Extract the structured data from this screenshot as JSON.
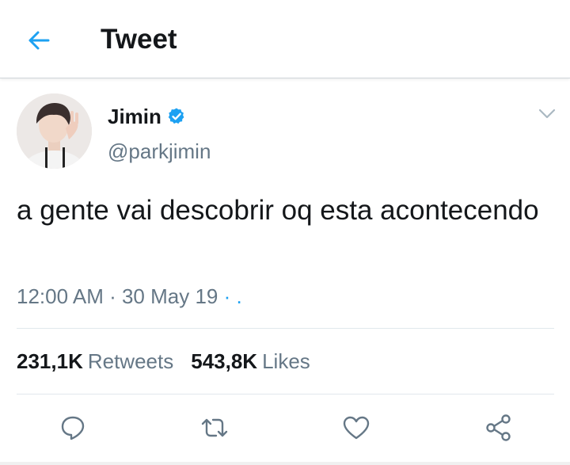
{
  "header": {
    "title": "Tweet",
    "back_icon": "arrow-left-icon",
    "accent": "#1da1f2"
  },
  "tweet": {
    "author_name": "Jimin",
    "verified": true,
    "handle": "@parkjimin",
    "text": "a gente vai descobrir oq esta acontecendo",
    "time": "12:00 AM",
    "date": "30 May 19",
    "separator": " · ",
    "trailing": " · .",
    "retweet_count": "231,1K",
    "retweet_label": "Retweets",
    "like_count": "543,8K",
    "like_label": "Likes"
  },
  "actions": [
    {
      "name": "reply",
      "icon": "reply-icon"
    },
    {
      "name": "retweet",
      "icon": "retweet-icon"
    },
    {
      "name": "like",
      "icon": "heart-icon"
    },
    {
      "name": "share",
      "icon": "share-icon"
    }
  ],
  "colors": {
    "text": "#14171a",
    "secondary": "#657786",
    "link": "#1da1f2",
    "verified": "#1da1f2",
    "divider": "#e1e8ed"
  }
}
